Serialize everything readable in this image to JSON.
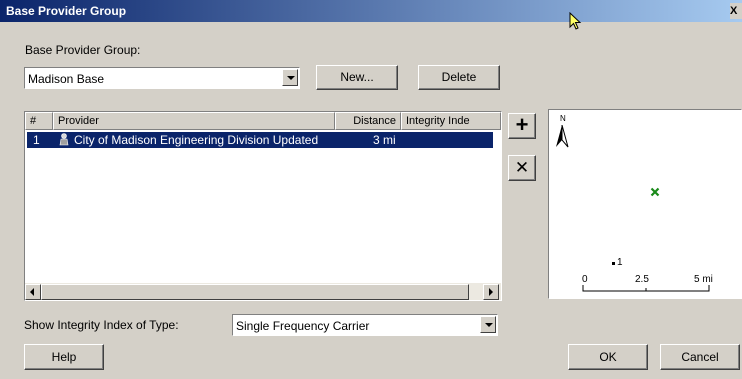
{
  "window": {
    "title": "Base Provider Group",
    "close_glyph": "X"
  },
  "group": {
    "label": "Base Provider Group:",
    "selected": "Madison Base",
    "new_label": "New...",
    "delete_label": "Delete"
  },
  "table": {
    "headers": [
      "#",
      "Provider",
      "Distance",
      "Integrity Inde"
    ],
    "rows": [
      {
        "num": "1",
        "provider": "City of Madison Engineering Division Updated",
        "distance": "3 mi",
        "integrity": ""
      }
    ]
  },
  "side_buttons": {
    "add_glyph": "+",
    "remove_glyph": "✕"
  },
  "map": {
    "north_label": "N",
    "point_label": "1",
    "scale_labels": [
      "0",
      "2.5",
      "5 mi"
    ],
    "marker_color": "#1a8a1a"
  },
  "integrity": {
    "label": "Show Integrity Index of Type:",
    "selected": "Single Frequency Carrier"
  },
  "footer": {
    "help_label": "Help",
    "ok_label": "OK",
    "cancel_label": "Cancel"
  }
}
